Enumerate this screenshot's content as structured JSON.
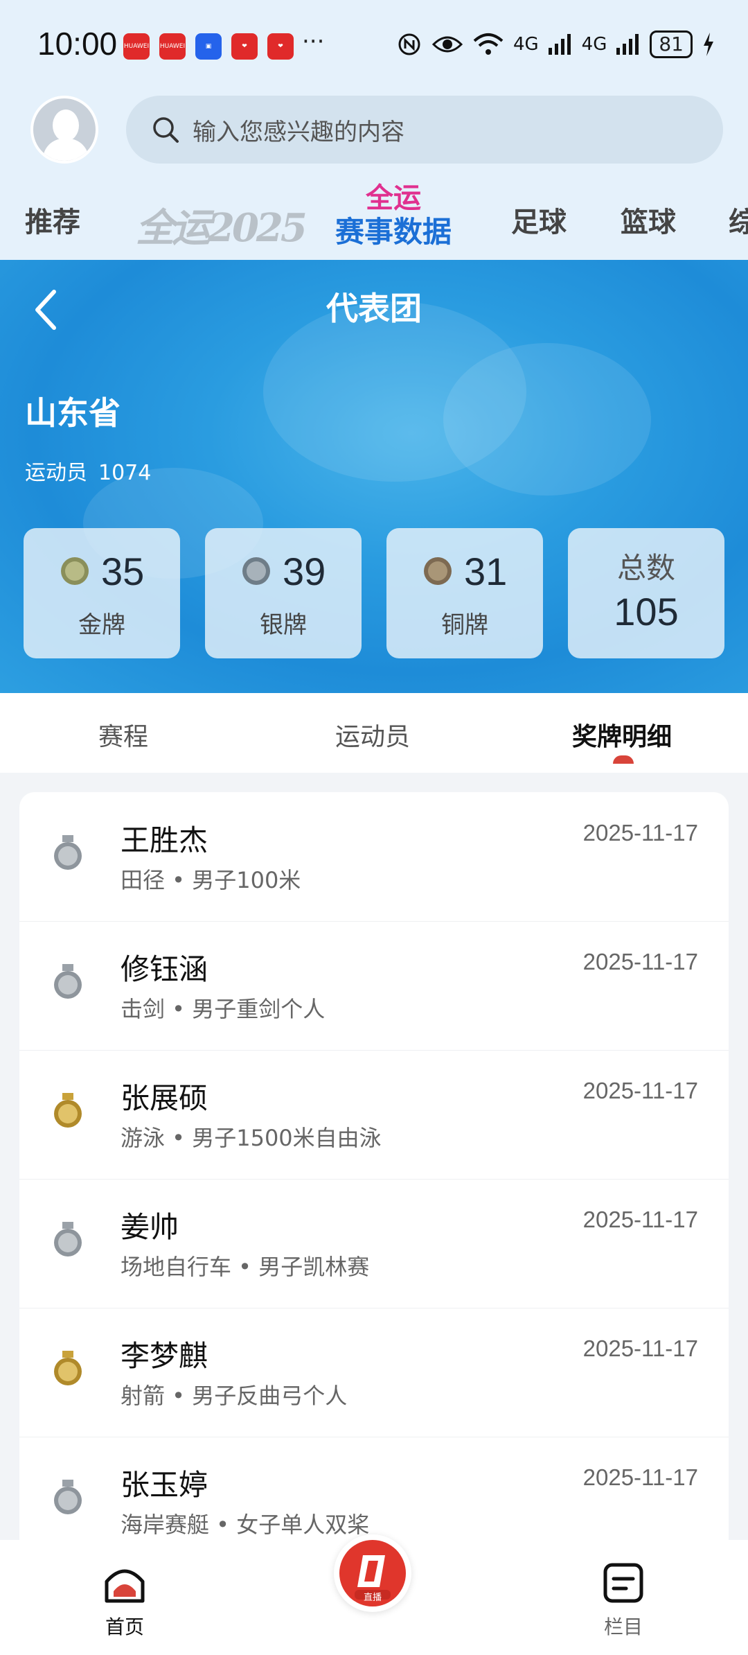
{
  "status_bar": {
    "time": "10:00",
    "more": "···",
    "battery": "81",
    "network": "4G"
  },
  "search": {
    "placeholder": "输入您感兴趣的内容"
  },
  "top_tabs": {
    "recommend": "推荐",
    "quanyun_logo": "全运2025",
    "event_data_line1": "全运",
    "event_data_line2": "赛事数据",
    "football": "足球",
    "basketball": "篮球",
    "partial": "综"
  },
  "header": {
    "title": "代表团"
  },
  "delegation": {
    "province": "山东省",
    "athletes_label": "运动员",
    "athletes_count": "1074"
  },
  "medals": {
    "gold": {
      "count": "35",
      "label": "金牌"
    },
    "silver": {
      "count": "39",
      "label": "银牌"
    },
    "bronze": {
      "count": "31",
      "label": "铜牌"
    },
    "total": {
      "label": "总数",
      "count": "105"
    }
  },
  "sub_tabs": {
    "schedule": "赛程",
    "athletes": "运动员",
    "medal_details": "奖牌明细"
  },
  "medal_list": [
    {
      "name": "王胜杰",
      "detail": "田径 • 男子100米",
      "date": "2025-11-17",
      "medal": "silver"
    },
    {
      "name": "修钰涵",
      "detail": "击剑 • 男子重剑个人",
      "date": "2025-11-17",
      "medal": "silver"
    },
    {
      "name": "张展硕",
      "detail": "游泳 • 男子1500米自由泳",
      "date": "2025-11-17",
      "medal": "gold"
    },
    {
      "name": "姜帅",
      "detail": "场地自行车 • 男子凯林赛",
      "date": "2025-11-17",
      "medal": "silver"
    },
    {
      "name": "李梦麒",
      "detail": "射箭 • 男子反曲弓个人",
      "date": "2025-11-17",
      "medal": "gold"
    },
    {
      "name": "张玉婷",
      "detail": "海岸赛艇 • 女子单人双桨",
      "date": "2025-11-17",
      "medal": "silver"
    }
  ],
  "bottom_nav": {
    "home": "首页",
    "live": "直播",
    "columns": "栏目"
  },
  "colors": {
    "accent_red": "#d8443a",
    "hero_blue": "#2a9ce0",
    "gold": "#c9a23a",
    "silver": "#9aa1a8"
  }
}
